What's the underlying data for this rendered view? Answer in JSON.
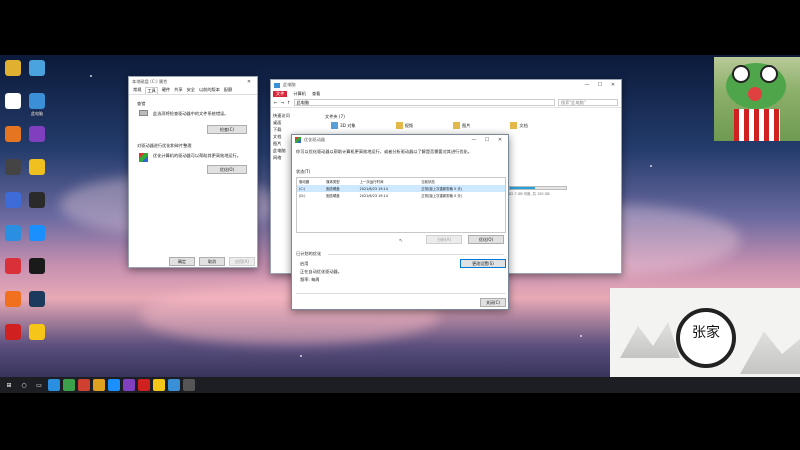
{
  "properties_window": {
    "title": "本地磁盘 (C:) 属性",
    "tabs": [
      "常规",
      "工具",
      "硬件",
      "共享",
      "安全",
      "以前的版本",
      "配额"
    ],
    "section1_title": "查错",
    "section1_text": "此选项将检查驱动器中的文件系统错误。",
    "section1_button": "检查(C)",
    "section2_title": "对驱动器进行优化和碎片整理",
    "section2_text": "优化计算机的驱动器可以帮助其更高效地运行。",
    "section2_button": "优化(O)",
    "ok": "确定",
    "cancel": "取消",
    "apply": "应用(A)"
  },
  "explorer": {
    "title": "此电脑",
    "menu": [
      "文件",
      "计算机",
      "查看"
    ],
    "address": "此电脑",
    "search_placeholder": "搜索\"此电脑\"",
    "sidebar": [
      "快速访问",
      "桌面",
      "下载",
      "文档",
      "图片",
      "此电脑",
      "网络"
    ],
    "folders_header": "文件夹 (7)",
    "folders": [
      "3D 对象",
      "视频",
      "图片",
      "文档"
    ],
    "drive_free": "82.7 GB 可用, 共 150 GB"
  },
  "optimize_dialog": {
    "title": "优化驱动器",
    "description": "你可以优化驱动器以帮助计算机更高效地运行，或者分析驱动器以了解是否需要对其进行优化。",
    "status_label": "状态(T)",
    "columns": [
      "驱动器",
      "媒体类型",
      "上一次运行时间",
      "当前状态"
    ],
    "rows": [
      [
        "(C:)",
        "固态硬盘",
        "2021/6/23 19:14",
        "正常(距上次重新剪裁 0 天)"
      ],
      [
        "(D:)",
        "固态硬盘",
        "2021/6/23 19:14",
        "正常(距上次重新剪裁 0 天)"
      ]
    ],
    "analyze_button": "分析(A)",
    "optimize_button": "优化(O)",
    "scheduled_title": "已计划的优化",
    "scheduled_state": "启用",
    "scheduled_desc": "正在自动优化驱动器。",
    "frequency": "频率: 每周",
    "change_settings": "更改设置(S)",
    "close": "关闭(C)"
  },
  "desktop_icons": [
    {
      "label": "",
      "color": "#e0b030"
    },
    {
      "label": "",
      "color": "#4aa3df"
    },
    {
      "label": "",
      "color": "#ffffff"
    },
    {
      "label": "此电脑",
      "color": "#3a8fd6"
    },
    {
      "label": "",
      "color": "#e57520"
    },
    {
      "label": "",
      "color": "#7f3fbf"
    },
    {
      "label": "",
      "color": "#444"
    },
    {
      "label": "",
      "color": "#f0c020"
    },
    {
      "label": "",
      "color": "#3d6bd8"
    },
    {
      "label": "",
      "color": "#2a2a2a"
    },
    {
      "label": "",
      "color": "#2a8fe0"
    },
    {
      "label": "",
      "color": "#1a90ff"
    },
    {
      "label": "",
      "color": "#d9303a"
    },
    {
      "label": "",
      "color": "#1a1a1a"
    },
    {
      "label": "",
      "color": "#f07020"
    },
    {
      "label": "",
      "color": "#1b3a5c"
    },
    {
      "label": "",
      "color": "#d02020"
    },
    {
      "label": "",
      "color": "#f5c518"
    }
  ],
  "colors": {
    "accent": "#0078d7",
    "taskbar": "#1c1e24",
    "explorer_red_tab": "#d6263a",
    "progress": "#26a0da"
  },
  "drive_usage_fraction": 0.45,
  "watermark_text": "张家"
}
